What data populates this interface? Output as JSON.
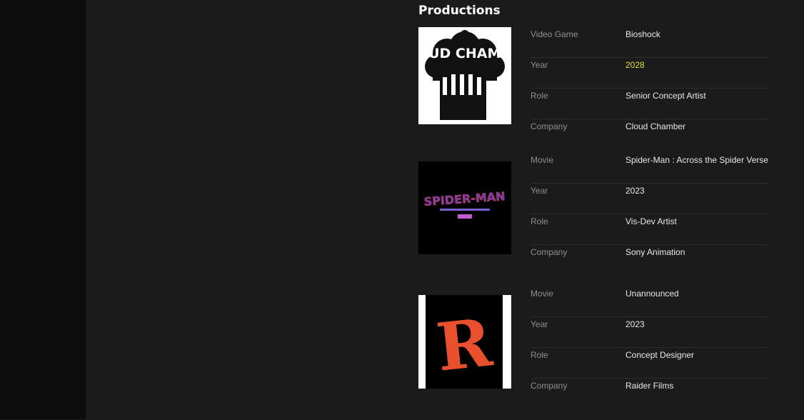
{
  "section": {
    "title": "Productions"
  },
  "productions": [
    {
      "image_alt": "CLOUD CHAMBER",
      "type_label": "Video Game",
      "title": "Bioshock",
      "year_label": "Year",
      "year": "2028",
      "role_label": "Role",
      "role": "Senior Concept Artist",
      "company_label": "Company",
      "company": "Cloud Chamber"
    },
    {
      "image_alt": "SPIDER-MAN ACROSS THE SPIDER-VERSE",
      "type_label": "Movie",
      "title": "Spider-Man : Across the Spider Verse",
      "year_label": "Year",
      "year": "2023",
      "role_label": "Role",
      "role": "Vis-Dev Artist",
      "company_label": "Company",
      "company": "Sony Animation"
    },
    {
      "image_alt": "R",
      "type_label": "Movie",
      "title": "Unannounced",
      "year_label": "Year",
      "year": "2023",
      "role_label": "Role",
      "role": "Concept Designer",
      "company_label": "Company",
      "company": "Raider Films"
    }
  ],
  "colors": {
    "background": "#1b1b1b",
    "rail": "#0d0d0d",
    "label": "#8f8f8f",
    "value": "#e8e8e8",
    "year_highlight": "#e8df3a",
    "raider_logo": "#e9502e"
  }
}
